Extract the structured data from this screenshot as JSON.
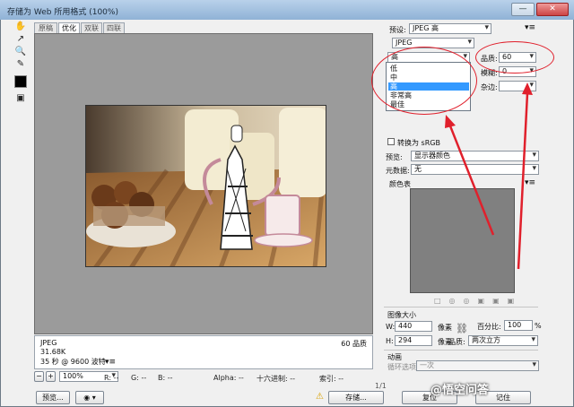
{
  "window": {
    "title": "存储为 Web 所用格式 (100%)",
    "minimize_label": "—",
    "close_label": "✕"
  },
  "tabs": [
    {
      "label": "原稿"
    },
    {
      "label": "优化"
    },
    {
      "label": "双联"
    },
    {
      "label": "四联"
    }
  ],
  "image_info": {
    "format": "JPEG",
    "size": "31.68K",
    "load_time": "35 秒 @ 9600 波特",
    "quality_text": "60 品质"
  },
  "statusbar": {
    "zoom": "100%",
    "r": "R: --",
    "g": "G: --",
    "b": "B: --",
    "alpha": "Alpha: --",
    "hex": "十六进制: --",
    "index": "索引: --",
    "page": "1/1"
  },
  "bottom_buttons": {
    "preview": "预览...",
    "save": "存储...",
    "reset": "复位",
    "remember": "记住"
  },
  "settings": {
    "preset_label": "预设:",
    "preset_value": "JPEG 高",
    "format_value": "JPEG",
    "quality_level_value": "高",
    "quality_label": "品质:",
    "quality_value": "60",
    "blur_label": "模糊:",
    "blur_value": "0",
    "matte_label": "杂边:",
    "quality_options": [
      "低",
      "中",
      "高",
      "非常高",
      "最佳"
    ],
    "selected_option": "高",
    "convert_srgb": "转换为 sRGB",
    "preview_label": "预览:",
    "preview_value": "显示器颜色",
    "metadata_label": "元数据:",
    "metadata_value": "无",
    "color_table_label": "颜色表"
  },
  "image_size": {
    "section_label": "图像大小",
    "w_label": "W:",
    "w_value": "440",
    "w_unit": "像素",
    "h_label": "H:",
    "h_value": "294",
    "h_unit": "像素",
    "percent_label": "百分比:",
    "percent_value": "100",
    "percent_unit": "%",
    "quality_label": "品质:",
    "quality_value": "两次立方"
  },
  "animation": {
    "section_label": "动画",
    "loop_label": "循环选项:",
    "loop_value": "一次"
  },
  "watermark": "@悟空问答",
  "colors": {
    "highlight": "#3399ff",
    "annotation_red": "#e0202c",
    "preview_bg": "#9b9b9b",
    "color_table": "#808080"
  }
}
